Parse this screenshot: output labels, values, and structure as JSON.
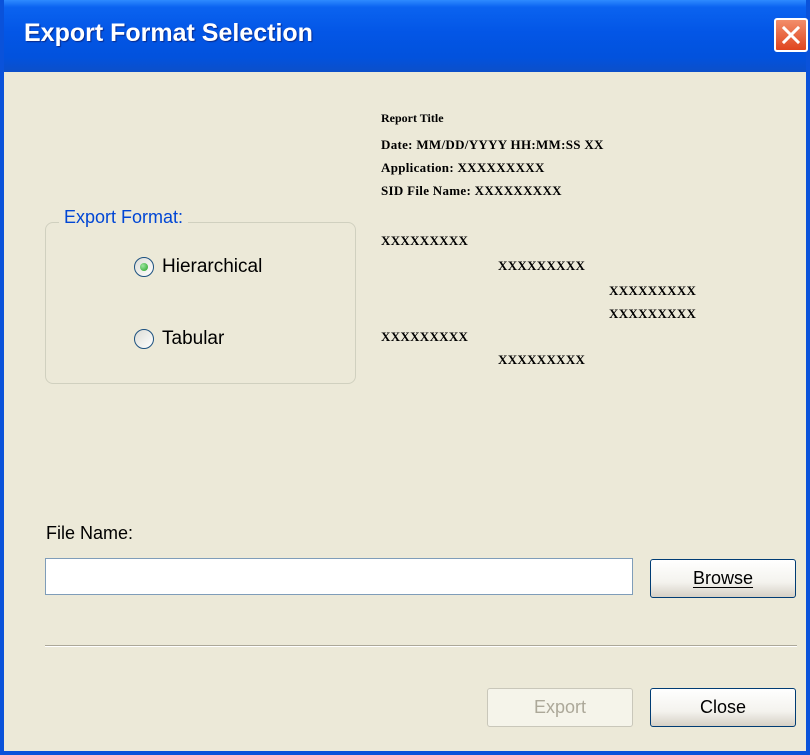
{
  "window": {
    "title": "Export Format Selection"
  },
  "export_format": {
    "legend": "Export Format:",
    "options": [
      {
        "label": "Hierarchical",
        "selected": true
      },
      {
        "label": "Tabular",
        "selected": false
      }
    ]
  },
  "preview": {
    "report_title": "Report Title",
    "date_line": "Date: MM/DD/YYYY HH:MM:SS XX",
    "application_line": "Application: XXXXXXXXX",
    "sid_line": "SID File Name: XXXXXXXXX",
    "rows": [
      "XXXXXXXXX",
      "XXXXXXXXX",
      "XXXXXXXXX",
      "XXXXXXXXX",
      "XXXXXXXXX",
      "XXXXXXXXX"
    ]
  },
  "file": {
    "label": "File Name:",
    "value": "",
    "browse_label": "Browse"
  },
  "footer": {
    "export_label": "Export",
    "close_label": "Close"
  },
  "colors": {
    "titlebar": "#0356E6",
    "dialog_bg": "#ECE9D8",
    "legend_text": "#0046D5",
    "close_button": "#E0451F"
  }
}
